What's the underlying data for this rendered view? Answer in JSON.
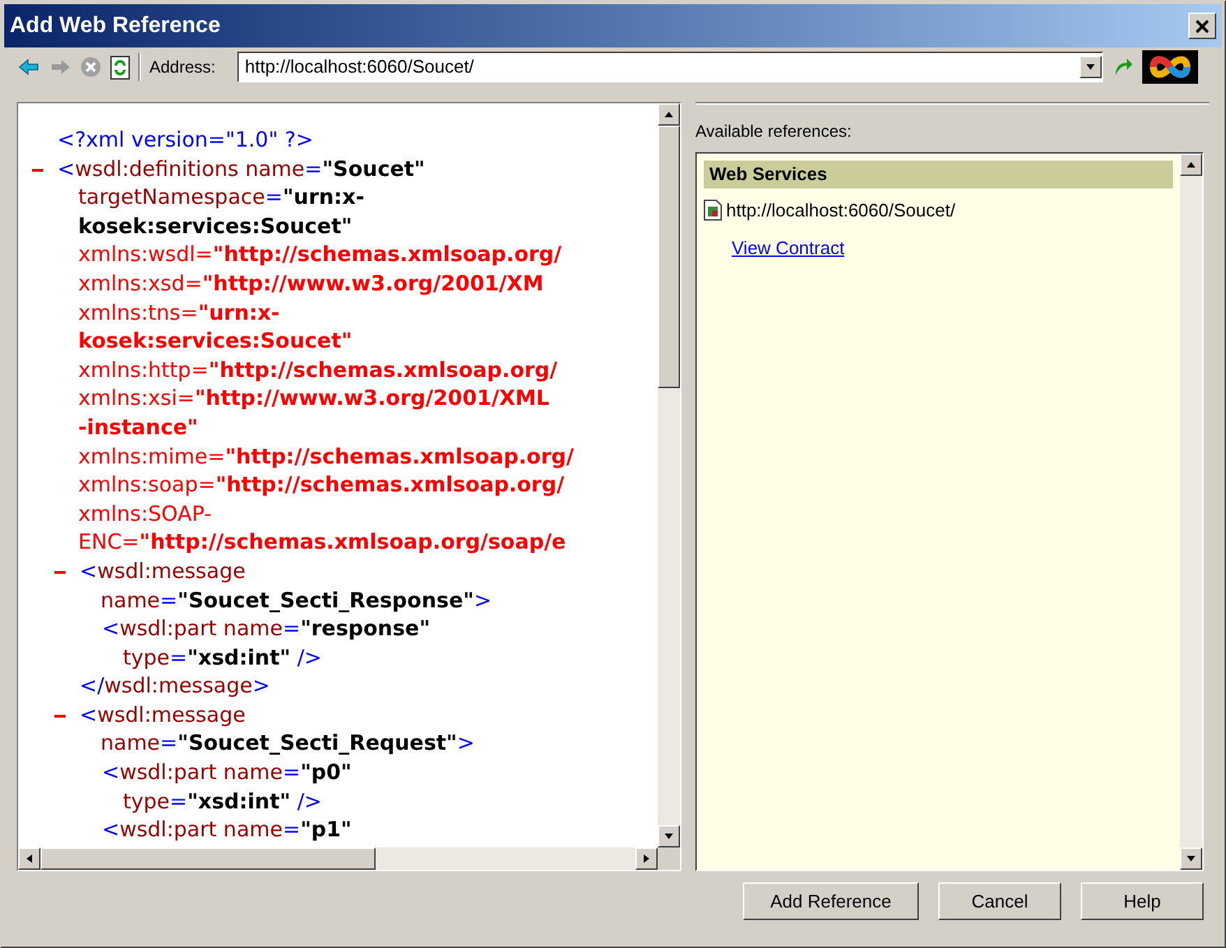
{
  "window": {
    "title": "Add Web Reference"
  },
  "toolbar": {
    "address_label": "Address:",
    "address": "http://localhost:6060/Soucet/"
  },
  "xml_view": {
    "prolog": [
      {
        "kind": "tag",
        "text": "<?xml version=\"1.0\" ?>"
      }
    ],
    "root": {
      "expanded": true,
      "lines": [
        [
          {
            "kind": "tag",
            "text": "<"
          },
          {
            "kind": "attr",
            "text": "wsdl:definitions name"
          },
          {
            "kind": "tag",
            "text": "="
          },
          {
            "kind": "value",
            "text": "\"Soucet\""
          }
        ],
        [
          {
            "kind": "attr",
            "text": "targetNamespace"
          },
          {
            "kind": "tag",
            "text": "="
          },
          {
            "kind": "value",
            "text": "\"urn:x-"
          }
        ],
        [
          {
            "kind": "value",
            "text": "kosek:services:Soucet\""
          }
        ],
        [
          {
            "kind": "ns",
            "text": "xmlns:wsdl="
          },
          {
            "kind": "nsvalue",
            "text": "\"http://schemas.xmlsoap.org/"
          }
        ],
        [
          {
            "kind": "ns",
            "text": "xmlns:xsd="
          },
          {
            "kind": "nsvalue",
            "text": "\"http://www.w3.org/2001/XM"
          }
        ],
        [
          {
            "kind": "ns",
            "text": "xmlns:tns="
          },
          {
            "kind": "nsvalue",
            "text": "\"urn:x-"
          }
        ],
        [
          {
            "kind": "nsvalue",
            "text": "kosek:services:Soucet\""
          }
        ],
        [
          {
            "kind": "ns",
            "text": "xmlns:http="
          },
          {
            "kind": "nsvalue",
            "text": "\"http://schemas.xmlsoap.org/"
          }
        ],
        [
          {
            "kind": "ns",
            "text": "xmlns:xsi="
          },
          {
            "kind": "nsvalue",
            "text": "\"http://www.w3.org/2001/XML"
          }
        ],
        [
          {
            "kind": "nsvalue",
            "text": "-instance\""
          }
        ],
        [
          {
            "kind": "ns",
            "text": "xmlns:mime="
          },
          {
            "kind": "nsvalue",
            "text": "\"http://schemas.xmlsoap.org/"
          }
        ],
        [
          {
            "kind": "ns",
            "text": "xmlns:soap="
          },
          {
            "kind": "nsvalue",
            "text": "\"http://schemas.xmlsoap.org/"
          }
        ],
        [
          {
            "kind": "ns",
            "text": "xmlns:SOAP-"
          }
        ],
        [
          {
            "kind": "ns",
            "text": "ENC="
          },
          {
            "kind": "nsvalue",
            "text": "\"http://schemas.xmlsoap.org/soap/e"
          }
        ]
      ],
      "children": [
        {
          "expanded": true,
          "lines": [
            [
              {
                "kind": "tag",
                "text": "<"
              },
              {
                "kind": "attr",
                "text": "wsdl:message"
              }
            ],
            [
              {
                "kind": "attr",
                "text": "name"
              },
              {
                "kind": "tag",
                "text": "="
              },
              {
                "kind": "value",
                "text": "\"Soucet_Secti_Response\""
              },
              {
                "kind": "tag",
                "text": ">"
              }
            ]
          ],
          "children": [
            {
              "lines": [
                [
                  {
                    "kind": "tag",
                    "text": "<"
                  },
                  {
                    "kind": "attr",
                    "text": "wsdl:part name"
                  },
                  {
                    "kind": "tag",
                    "text": "="
                  },
                  {
                    "kind": "value",
                    "text": "\"response\""
                  }
                ],
                [
                  {
                    "kind": "attr",
                    "text": "type"
                  },
                  {
                    "kind": "tag",
                    "text": "="
                  },
                  {
                    "kind": "value",
                    "text": "\"xsd:int\""
                  },
                  {
                    "kind": "tag",
                    "text": " />"
                  }
                ]
              ]
            }
          ],
          "closing": [
            {
              "kind": "tag",
              "text": "</"
            },
            {
              "kind": "attr",
              "text": "wsdl:message"
            },
            {
              "kind": "tag",
              "text": ">"
            }
          ]
        },
        {
          "expanded": true,
          "lines": [
            [
              {
                "kind": "tag",
                "text": "<"
              },
              {
                "kind": "attr",
                "text": "wsdl:message"
              }
            ],
            [
              {
                "kind": "attr",
                "text": "name"
              },
              {
                "kind": "tag",
                "text": "="
              },
              {
                "kind": "value",
                "text": "\"Soucet_Secti_Request\""
              },
              {
                "kind": "tag",
                "text": ">"
              }
            ]
          ],
          "children": [
            {
              "lines": [
                [
                  {
                    "kind": "tag",
                    "text": "<"
                  },
                  {
                    "kind": "attr",
                    "text": "wsdl:part name"
                  },
                  {
                    "kind": "tag",
                    "text": "="
                  },
                  {
                    "kind": "value",
                    "text": "\"p0\""
                  }
                ],
                [
                  {
                    "kind": "attr",
                    "text": "type"
                  },
                  {
                    "kind": "tag",
                    "text": "="
                  },
                  {
                    "kind": "value",
                    "text": "\"xsd:int\""
                  },
                  {
                    "kind": "tag",
                    "text": " />"
                  }
                ]
              ]
            },
            {
              "lines": [
                [
                  {
                    "kind": "tag",
                    "text": "<"
                  },
                  {
                    "kind": "attr",
                    "text": "wsdl:part name"
                  },
                  {
                    "kind": "tag",
                    "text": "="
                  },
                  {
                    "kind": "value",
                    "text": "\"p1\""
                  }
                ]
              ]
            }
          ]
        }
      ]
    }
  },
  "references": {
    "label": "Available references:",
    "section": "Web Services",
    "items": [
      {
        "url": "http://localhost:6060/Soucet/",
        "link": "View Contract"
      }
    ]
  },
  "buttons": [
    "Add Reference",
    "Cancel",
    "Help"
  ]
}
